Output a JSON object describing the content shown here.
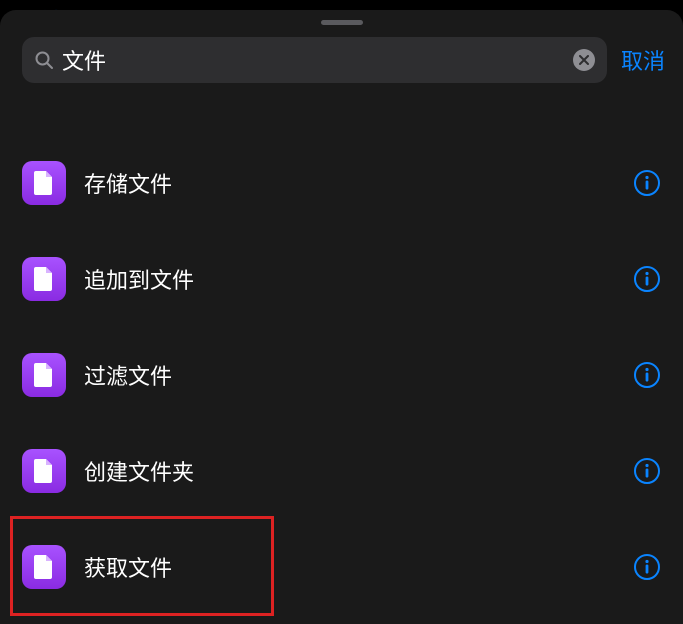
{
  "backdrop_cancel": "取消",
  "search": {
    "value": "文件",
    "cancel_label": "取消"
  },
  "results": [
    {
      "label": "存储文件"
    },
    {
      "label": "追加到文件"
    },
    {
      "label": "过滤文件"
    },
    {
      "label": "创建文件夹"
    },
    {
      "label": "获取文件"
    }
  ],
  "colors": {
    "accent": "#0a84ff",
    "icon_bg": "#8a2be2"
  }
}
